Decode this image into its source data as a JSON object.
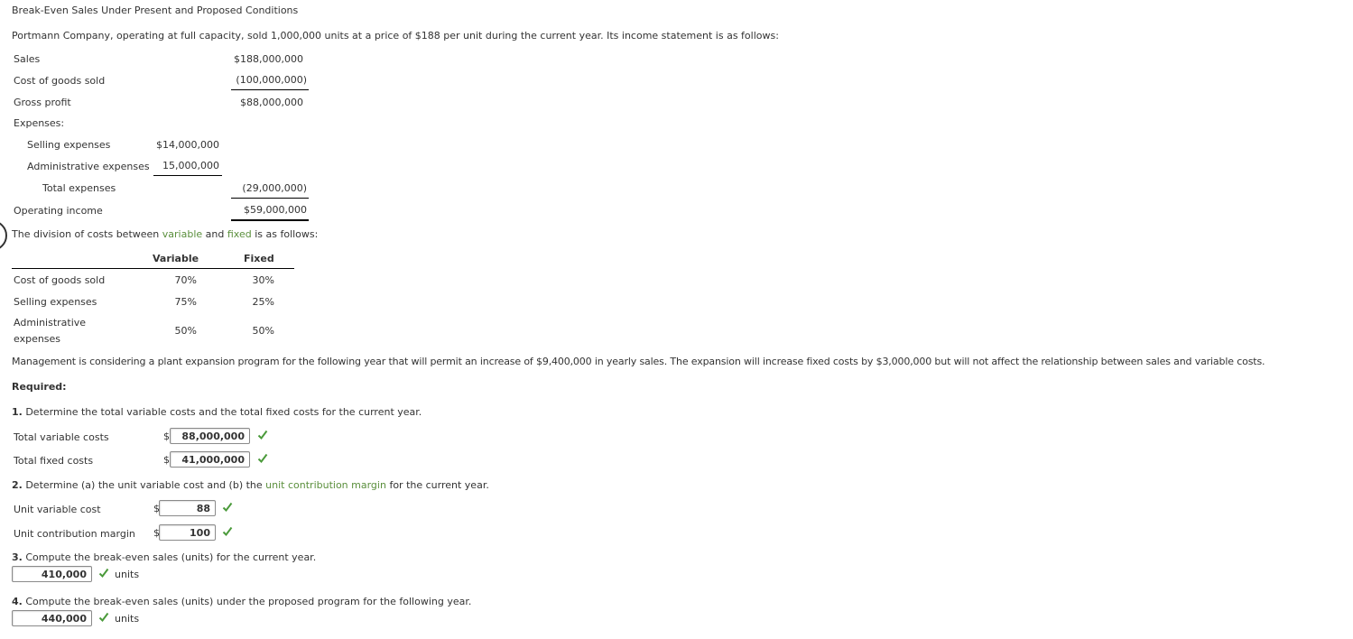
{
  "title": "Break-Even Sales Under Present and Proposed Conditions",
  "intro": "Portmann Company, operating at full capacity, sold 1,000,000 units at a price of $188 per unit during the current year. Its income statement is as follows:",
  "income_statement": {
    "sales_label": "Sales",
    "sales_value": "$188,000,000",
    "cogs_label": "Cost of goods sold",
    "cogs_value": "(100,000,000)",
    "gross_profit_label": "Gross profit",
    "gross_profit_value": "$88,000,000",
    "expenses_label": "Expenses:",
    "selling_label": "Selling expenses",
    "selling_value": "$14,000,000",
    "admin_label": "Administrative expenses",
    "admin_value": "15,000,000",
    "total_exp_label": "Total expenses",
    "total_exp_value": "(29,000,000)",
    "operating_income_label": "Operating income",
    "operating_income_value": "$59,000,000"
  },
  "division": {
    "text_pre": "The division of costs between ",
    "variable_link": "variable",
    "text_mid": " and ",
    "fixed_link": "fixed",
    "text_post": " is as follows:",
    "headers": [
      "Variable",
      "Fixed"
    ],
    "rows": [
      {
        "label": "Cost of goods sold",
        "variable": "70%",
        "fixed": "30%"
      },
      {
        "label": "Selling expenses",
        "variable": "75%",
        "fixed": "25%"
      },
      {
        "label_line1": "Administrative",
        "label_line2": "expenses",
        "variable": "50%",
        "fixed": "50%"
      }
    ]
  },
  "management_text": "Management is considering a plant expansion program for the following year that will permit an increase of $9,400,000 in yearly sales. The expansion will increase fixed costs by $3,000,000 but will not affect the relationship between sales and variable costs.",
  "required_label": "Required:",
  "q1": {
    "number": "1.",
    "text": " Determine the total variable costs and the total fixed costs for the current year.",
    "rows": [
      {
        "label": "Total variable costs",
        "currency": "$",
        "value": "88,000,000"
      },
      {
        "label": "Total fixed costs",
        "currency": "$",
        "value": "41,000,000"
      }
    ]
  },
  "q2": {
    "number": "2.",
    "text_pre": " Determine (a) the unit variable cost and (b) the ",
    "link": "unit contribution margin",
    "text_post": " for the current year.",
    "rows": [
      {
        "label": "Unit variable cost",
        "currency": "$",
        "value": "88"
      },
      {
        "label": "Unit contribution margin",
        "currency": "$",
        "value": "100"
      }
    ]
  },
  "q3": {
    "number": "3.",
    "text": " Compute the break-even sales (units) for the current year.",
    "value": "410,000",
    "unit": "units"
  },
  "q4": {
    "number": "4.",
    "text": " Compute the break-even sales (units) under the proposed program for the following year.",
    "value": "440,000",
    "unit": "units"
  },
  "colors": {
    "link_green": "#5a8f3c",
    "check_green": "#4a9a3a"
  },
  "icons": {
    "correct": "check-icon"
  }
}
